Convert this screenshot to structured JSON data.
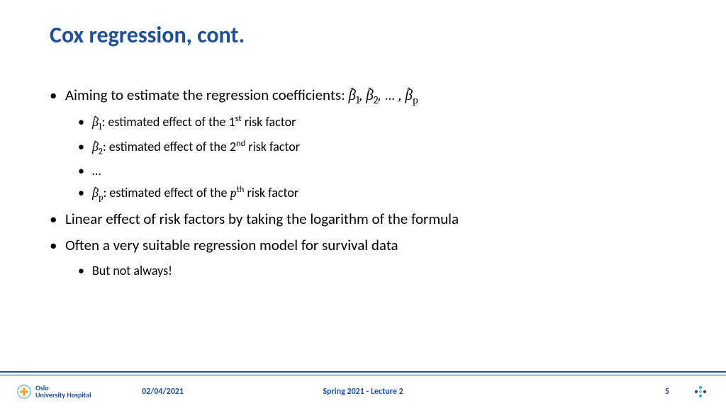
{
  "title": "Cox regression, cont.",
  "bullets": {
    "b1_prefix": "Aiming to estimate the regression coefficients: ",
    "b1s1_suffix": ": estimated effect of the 1",
    "b1s1_sup": "st",
    "b1s1_tail": " risk factor",
    "b1s2_suffix": ": estimated effect of the 2",
    "b1s2_sup": "nd",
    "b1s2_tail": " risk factor",
    "b1s3": "…",
    "b1s4_suffix": ": estimated effect of the ",
    "b1s4_var": "p",
    "b1s4_sup": "th",
    "b1s4_tail": " risk factor",
    "b2": "Linear effect of risk factors by taking the logarithm of the formula",
    "b3": "Often a very suitable regression model for survival data",
    "b3s1": "But not always!"
  },
  "math": {
    "beta": "β",
    "sub1": "1",
    "sub2": "2",
    "subp": "p",
    "comma": ", ",
    "dots": "… ,"
  },
  "footer": {
    "logo_line1": "Oslo",
    "logo_line2": "University Hospital",
    "date": "02/04/2021",
    "center": "Spring 2021 - Lecture 2",
    "page": "5"
  }
}
